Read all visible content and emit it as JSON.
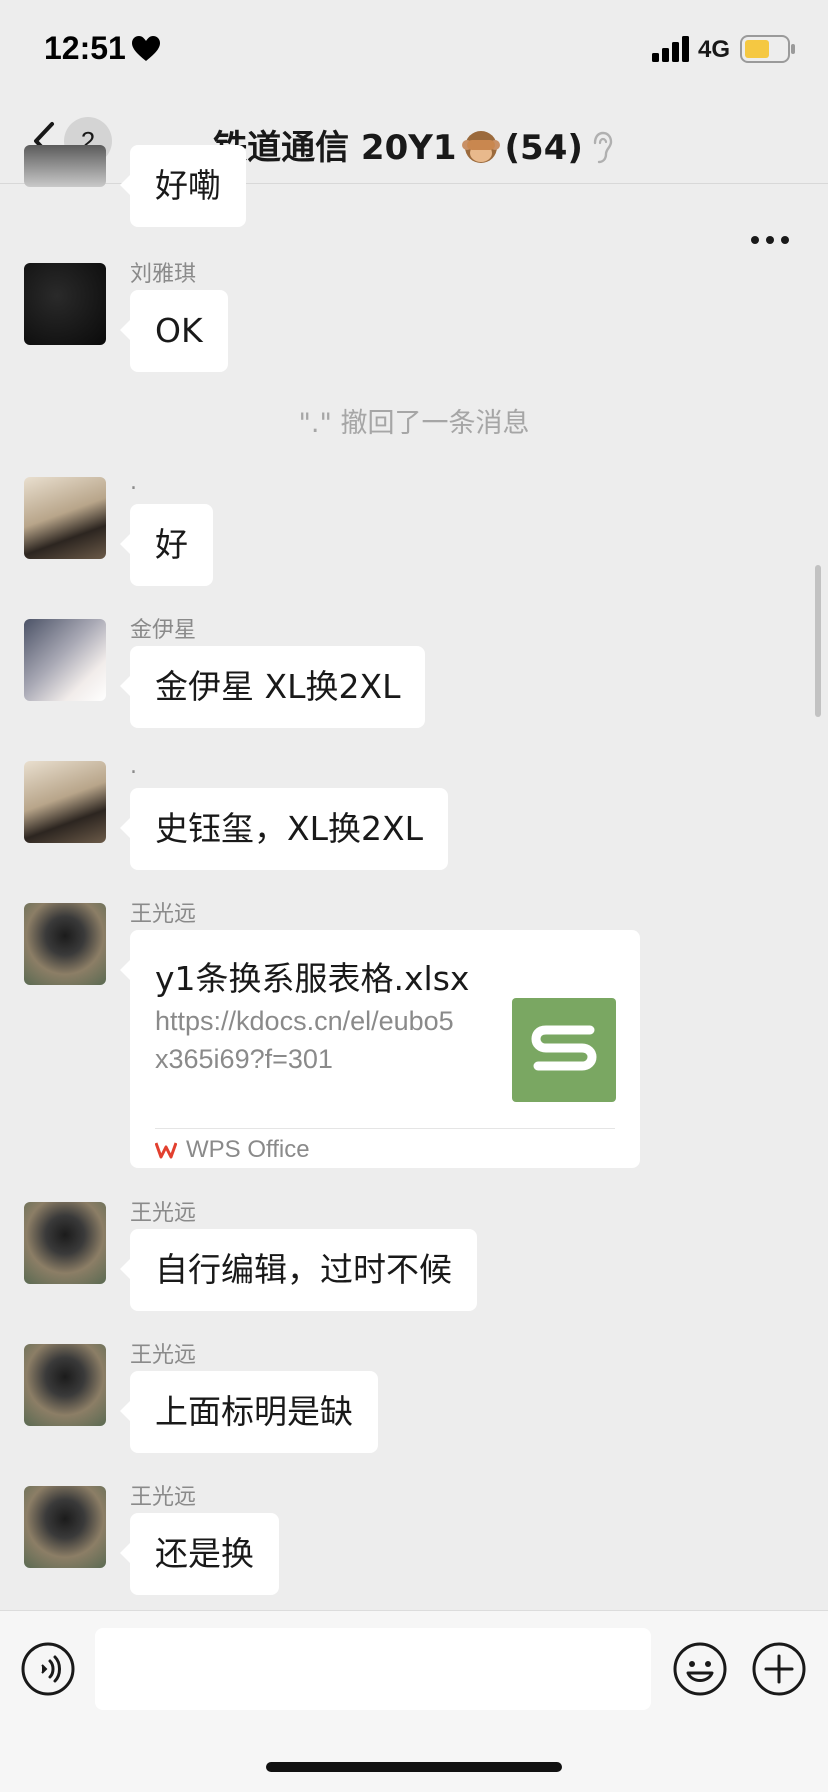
{
  "status_bar": {
    "time": "12:51",
    "network": "4G"
  },
  "nav": {
    "unread_count": "2",
    "title_prefix": "铁道通信 20Y1",
    "title_suffix": "(54)",
    "title_emoji_icon": "see-no-evil-monkey-icon",
    "mute_icon": "ear-off-icon"
  },
  "messages": [
    {
      "sender": "",
      "text": "好嘞"
    },
    {
      "sender": "刘雅琪",
      "text": "OK"
    },
    {
      "recall_text": "\".\" 撤回了一条消息"
    },
    {
      "sender": ".",
      "text": "好"
    },
    {
      "sender": "金伊星",
      "text": "金伊星 XL换2XL"
    },
    {
      "sender": ".",
      "text": "史钰玺，XL换2XL"
    },
    {
      "sender": "王光远",
      "file": {
        "title": "y1条换系服表格.xlsx",
        "url": "https://kdocs.cn/el/eubo5x365i69?f=301",
        "source": "WPS Office"
      }
    },
    {
      "sender": "王光远",
      "text": "自行编辑，过时不候"
    },
    {
      "sender": "王光远",
      "text": "上面标明是缺"
    },
    {
      "sender": "王光远",
      "text": "还是换"
    }
  ],
  "colors": {
    "background": "#ededed",
    "bubble": "#ffffff",
    "wps_thumb": "#7aa762",
    "battery_fill": "#f5c842"
  }
}
